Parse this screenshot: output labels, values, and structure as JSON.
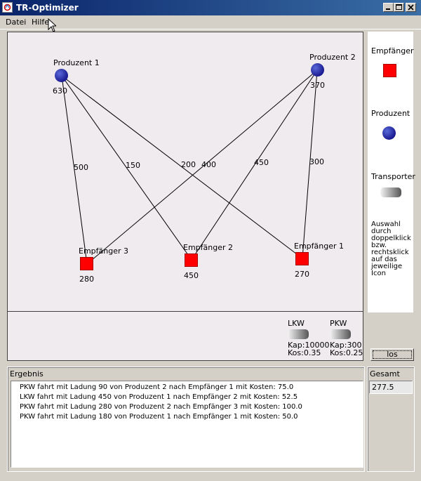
{
  "window": {
    "title": "TR-Optimizer"
  },
  "menu": {
    "items": [
      "Datei",
      "Hilfe"
    ]
  },
  "graph": {
    "producers": [
      {
        "name": "Produzent 1",
        "value": "630"
      },
      {
        "name": "Produzent 2",
        "value": "370"
      }
    ],
    "receivers": [
      {
        "name": "Empfänger 3",
        "value": "280"
      },
      {
        "name": "Empfänger 2",
        "value": "450"
      },
      {
        "name": "Empfänger 1",
        "value": "270"
      }
    ],
    "edges": [
      {
        "from": "Produzent 1",
        "to": "Empfänger 3",
        "label": "500"
      },
      {
        "from": "Produzent 1",
        "to": "Empfänger 2",
        "label": "150"
      },
      {
        "from": "Produzent 1",
        "to": "Empfänger 1",
        "label": "200"
      },
      {
        "from": "Produzent 2",
        "to": "Empfänger 3",
        "label": "400"
      },
      {
        "from": "Produzent 2",
        "to": "Empfänger 2",
        "label": "450"
      },
      {
        "from": "Produzent 2",
        "to": "Empfänger 1",
        "label": "300"
      }
    ]
  },
  "fleet": {
    "vehicles": [
      {
        "name": "LKW",
        "capacity": "Kap:10000",
        "cost": "Kos:0.35"
      },
      {
        "name": "PKW",
        "capacity": "Kap:300",
        "cost": "Kos:0.25"
      }
    ]
  },
  "palette": {
    "receiver_label": "Empfänger",
    "producer_label": "Produzent",
    "transporter_label": "Transporter",
    "hint": "Auswahl durch doppelklick bzw. rechtsklick auf das jeweilige Icon"
  },
  "actions": {
    "run_label": "los"
  },
  "results": {
    "title": "Ergebnis",
    "lines": [
      "PKW fahrt mit Ladung 90 von Produzent 2 nach Empfänger 1 mit Kosten: 75.0",
      "LKW fahrt mit Ladung 450 von Produzent 1 nach Empfänger 2 mit Kosten: 52.5",
      "PKW fahrt mit Ladung 280 von Produzent 2 nach Empfänger 3 mit Kosten: 100.0",
      "PKW fahrt mit Ladung 180 von Produzent 1 nach Empfänger 1 mit Kosten: 50.0"
    ]
  },
  "total": {
    "title": "Gesamt",
    "value": "277.5"
  },
  "colors": {
    "titlebar": "#0a246a",
    "receiver": "#ff0000",
    "producer": "#1a1a90",
    "canvas": "#efebef"
  },
  "icons": {
    "app": "app-icon",
    "minimize": "minimize-icon",
    "maximize": "maximize-icon",
    "close": "close-icon",
    "cursor": "mouse-cursor-icon"
  }
}
